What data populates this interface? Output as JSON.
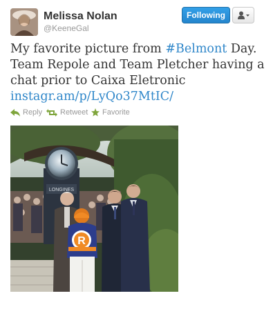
{
  "user": {
    "name": "Melissa Nolan",
    "handle": "@KeeneGal"
  },
  "buttons": {
    "follow_label": "Following",
    "user_menu_icon": "user-dropdown-icon"
  },
  "tweet": {
    "text_line1_before": "My favorite picture from ",
    "hashtag": "#Belmont",
    "text_line1_after": " Day.",
    "text_rest": "Team Repole and Team Pletcher having a chat prior to Caixa Eletronic",
    "link": "instagr.am/p/LyQo37MtIC/"
  },
  "actions": {
    "reply": "Reply",
    "retweet": "Retweet",
    "favorite": "Favorite"
  },
  "photo": {
    "clock_brand": "LONGINES",
    "jockey_silk_letter": "R"
  },
  "colors": {
    "link": "#2e86c9",
    "follow_button": "#2485cd",
    "action_icon": "#7fa53c",
    "muted_text": "#999999"
  }
}
